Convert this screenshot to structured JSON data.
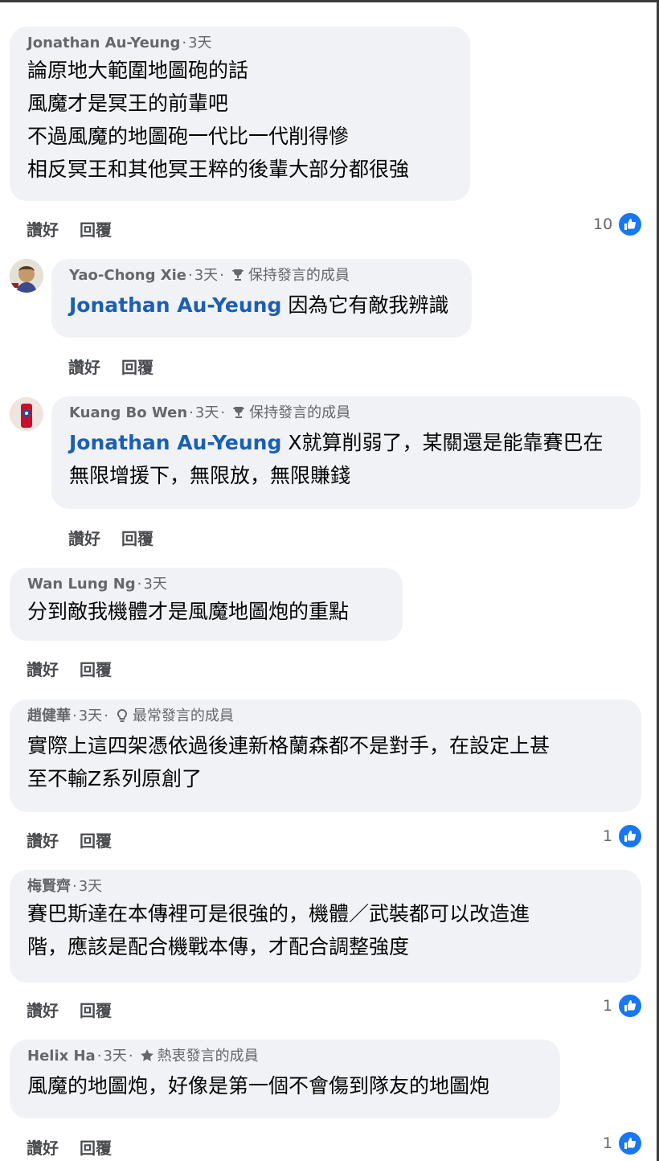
{
  "comments": [
    {
      "author": "Jonathan Au-Yeung",
      "time": "3天",
      "lines": [
        "論原地大範圍地圖砲的話",
        "風魔才是冥王的前輩吧",
        "不過風魔的地圖砲一代比一代削得慘",
        "相反冥王和其他冥王粹的後輩大部分都很強"
      ],
      "like_label": "讚好",
      "reply_label": "回覆",
      "reaction_count": "10"
    },
    {
      "author": "Yao-Chong Xie",
      "time": "3天",
      "badge_icon": "trophy-icon",
      "badge": "保持發言的成員",
      "mention": "Jonathan Au-Yeung",
      "lines": [
        "因為它有敵我辨識"
      ],
      "like_label": "讚好",
      "reply_label": "回覆"
    },
    {
      "author": "Kuang Bo Wen",
      "time": "3天",
      "badge_icon": "trophy-icon",
      "badge": "保持發言的成員",
      "mention": "Jonathan Au-Yeung",
      "lines": [
        "X就算削弱了，某關還是能靠賽巴在",
        "無限增援下，無限放，無限賺錢"
      ],
      "like_label": "讚好",
      "reply_label": "回覆"
    },
    {
      "author": "Wan Lung Ng",
      "time": "3天",
      "lines": [
        "分到敵我機體才是風魔地圖炮的重點"
      ],
      "like_label": "讚好",
      "reply_label": "回覆"
    },
    {
      "author": "趙健華",
      "time": "3天",
      "badge_icon": "lightbulb-icon",
      "badge": "最常發言的成員",
      "lines": [
        "實際上這四架憑依過後連新格蘭森都不是對手，在設定上甚",
        "至不輸Z系列原創了"
      ],
      "like_label": "讚好",
      "reply_label": "回覆",
      "reaction_count": "1"
    },
    {
      "author": "梅賢齊",
      "time": "3天",
      "lines": [
        "賽巴斯達在本傳裡可是很強的，機體／武裝都可以改造進",
        "階，應該是配合機戰本傳，才配合調整強度"
      ],
      "like_label": "讚好",
      "reply_label": "回覆",
      "reaction_count": "1"
    },
    {
      "author": "Helix Ha",
      "time": "3天",
      "badge_icon": "star-icon",
      "badge": "熱衷發言的成員",
      "lines": [
        "風魔的地圖炮，好像是第一個不會傷到隊友的地圖炮"
      ],
      "like_label": "讚好",
      "reply_label": "回覆",
      "reaction_count": "1"
    }
  ],
  "colors": {
    "bubble": "#f0f2f5",
    "mention": "#1b5fb4",
    "like_blue": "#1877f2",
    "meta_gray": "#65676b"
  }
}
